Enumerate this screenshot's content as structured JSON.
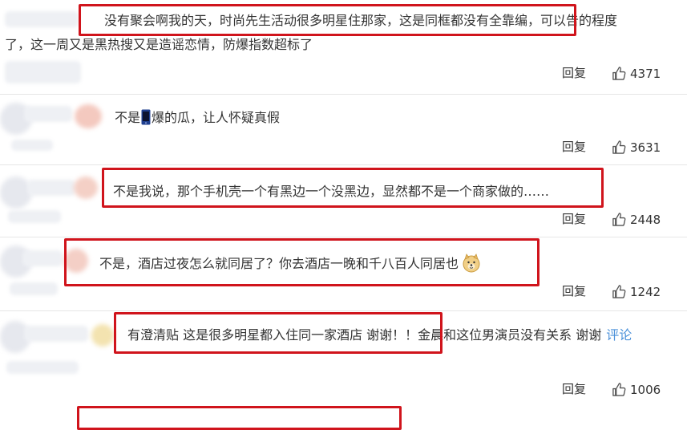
{
  "comments": [
    {
      "line1": "没有聚会啊我的天，时尚先生活动很多明星住那家，这是同框都没有全靠编，可以告的程度",
      "line2": "了，这一周又是黑热搜又是造谣恋情，防爆指数超标了",
      "reply": "回复",
      "likes": "4371"
    },
    {
      "text_before": "不是",
      "text_after": "爆的瓜，让人怀疑真假",
      "reply": "回复",
      "likes": "3631"
    },
    {
      "text": "不是我说，那个手机壳一个有黑边一个没黑边，显然都不是一个商家做的……",
      "reply": "回复",
      "likes": "2448"
    },
    {
      "text": "不是，酒店过夜怎么就同居了？你去酒店一晚和千八百人同居也",
      "reply": "回复",
      "likes": "1242"
    },
    {
      "text": "有澄清贴 这是很多明星都入住同一家酒店 谢谢！！金晨和这位男演员没有关系 谢谢",
      "link": "评论",
      "reply": "回复",
      "likes": "1006"
    }
  ],
  "icons": {
    "like": "thumbs-up-icon",
    "phone": "phone-icon",
    "emoji": "doge-icon"
  },
  "colors": {
    "highlight_box": "#d0141c",
    "link": "#4a90d9",
    "divider": "#e6e6e6",
    "text": "#333333"
  }
}
